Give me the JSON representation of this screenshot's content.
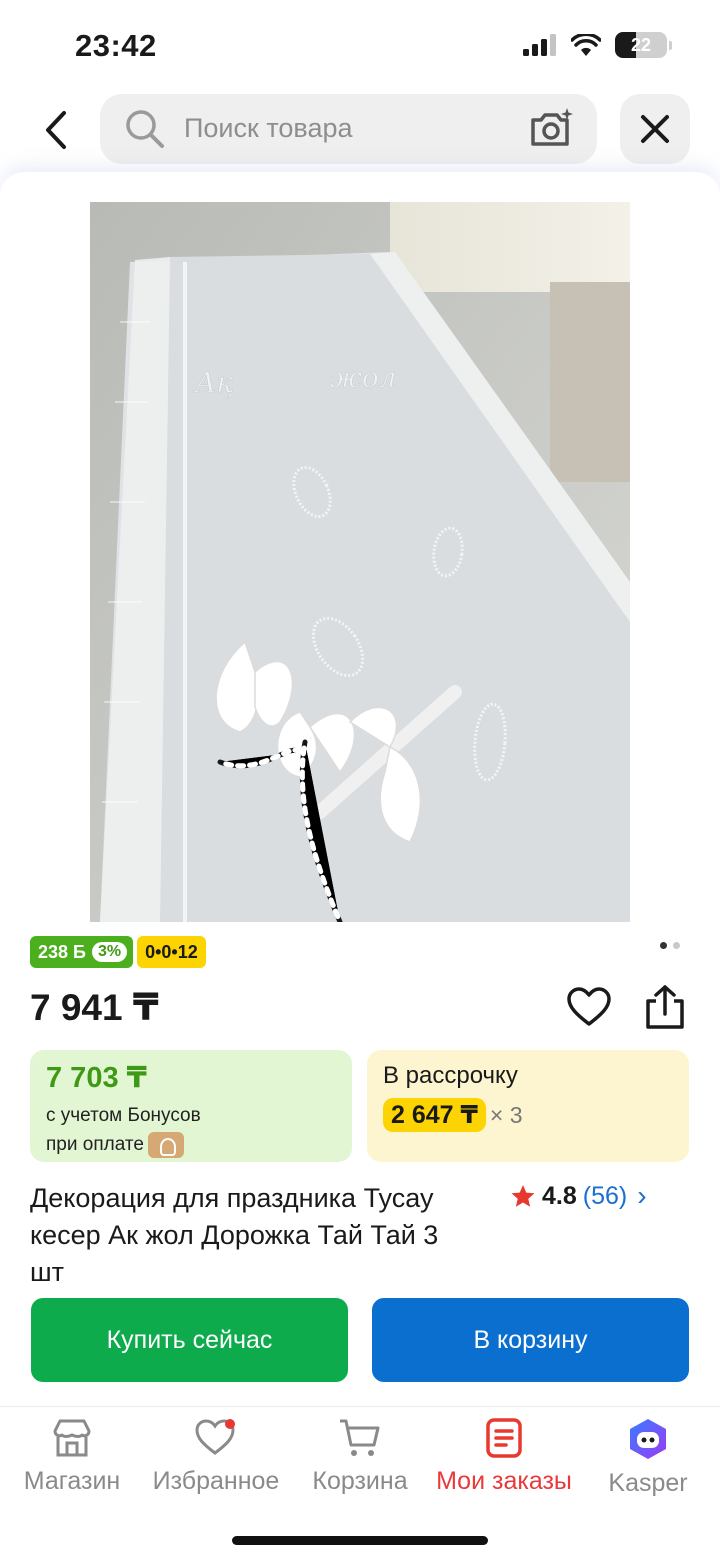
{
  "status_bar": {
    "time": "23:42",
    "battery": "22",
    "icons": [
      "signal-icon",
      "wifi-icon",
      "battery-icon"
    ]
  },
  "header": {
    "search_placeholder": "Поиск товара",
    "icons": [
      "back-arrow-icon",
      "search-icon",
      "camera-plus-icon",
      "close-icon"
    ]
  },
  "product": {
    "image_description": "",
    "badges": {
      "bonus_amount": "238 Б",
      "bonus_percent": "3%",
      "installment": "0•0•12"
    },
    "gallery_pages": 2,
    "gallery_active": 1,
    "price": "7 941 ₸",
    "bonus_card": {
      "price": "7 703 ₸",
      "line1": "с учетом Бонусов",
      "line2": "при оплате"
    },
    "installment_card": {
      "title": "В рассрочку",
      "monthly": "2 647 ₸",
      "multiplier": "× 3"
    },
    "title": "Декорация для праздника Тусау кесер Ак жол Дорожка Тай Тай 3 шт",
    "rating": {
      "value": "4.8",
      "count": "(56)"
    },
    "buy_now_label": "Купить сейчас",
    "add_to_cart_label": "В корзину"
  },
  "tabbar": {
    "items": [
      {
        "label": "Магазин",
        "icon": "store-icon",
        "active": false
      },
      {
        "label": "Избранное",
        "icon": "heart-icon",
        "active": false
      },
      {
        "label": "Корзина",
        "icon": "cart-icon",
        "active": false
      },
      {
        "label": "Мои заказы",
        "icon": "orders-icon",
        "active": true
      },
      {
        "label": "Kasper",
        "icon": "kasper-icon",
        "active": false
      }
    ]
  },
  "colors": {
    "green": "#0dab4c",
    "blue": "#0b6fd0",
    "bonus_green": "#3e9a14",
    "yellow": "#fcd303",
    "active_tab": "#e83a3a"
  }
}
